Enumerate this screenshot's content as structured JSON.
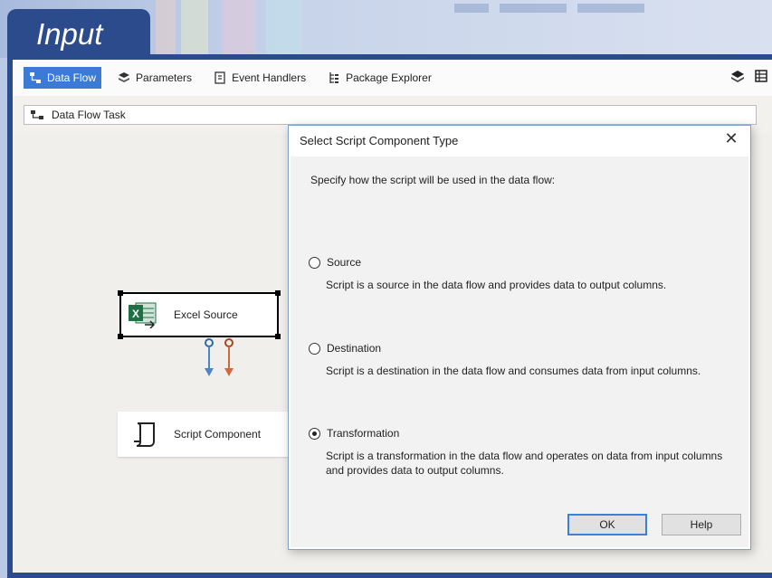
{
  "banner": {
    "title": "Input"
  },
  "toolbar": {
    "tabs": [
      {
        "label": "Data Flow",
        "icon": "data-flow-icon",
        "active": true
      },
      {
        "label": "Parameters",
        "icon": "parameters-icon",
        "active": false
      },
      {
        "label": "Event Handlers",
        "icon": "event-handlers-icon",
        "active": false
      },
      {
        "label": "Package Explorer",
        "icon": "package-explorer-icon",
        "active": false
      }
    ]
  },
  "task_selector": {
    "value": "Data Flow Task"
  },
  "canvas": {
    "excel_source": {
      "label": "Excel Source"
    },
    "script_component": {
      "label": "Script Component"
    }
  },
  "dialog": {
    "title": "Select Script Component Type",
    "instruction": "Specify how the script will be used in the data flow:",
    "options": [
      {
        "label": "Source",
        "description": "Script is a source in the data flow and provides data to output columns.",
        "checked": false
      },
      {
        "label": "Destination",
        "description": "Script is a destination in the data flow and consumes data from input columns.",
        "checked": false
      },
      {
        "label": "Transformation",
        "description": "Script is a transformation in the data flow and operates on data from input columns and provides data to output columns.",
        "checked": true
      }
    ],
    "ok_label": "OK",
    "help_label": "Help"
  },
  "colors": {
    "frame": "#2c4b8c",
    "active_tab": "#3b7bd6",
    "excel_green": "#1e7145"
  }
}
